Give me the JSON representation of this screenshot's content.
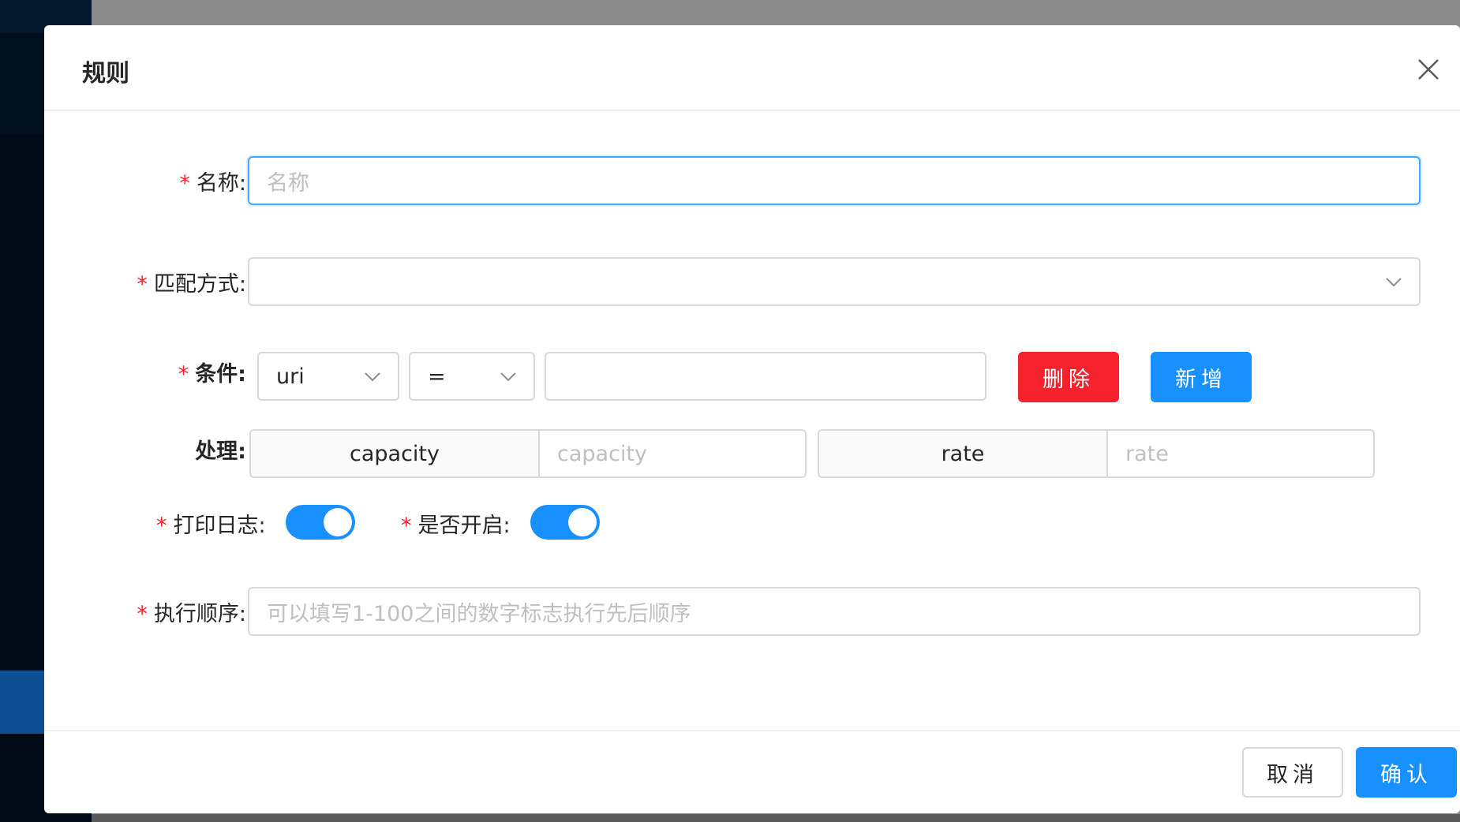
{
  "dialog": {
    "title": "规则",
    "close_icon": "close-icon"
  },
  "form": {
    "name": {
      "label": "名称:",
      "placeholder": "名称",
      "value": ""
    },
    "match_mode": {
      "label": "匹配方式:",
      "value": ""
    },
    "condition": {
      "label": "条件:",
      "param_type": "uri",
      "operator": "=",
      "value": "",
      "delete_label": "删除",
      "add_label": "新增"
    },
    "handle": {
      "label": "处理:",
      "capacity_addon": "capacity",
      "capacity_placeholder": "capacity",
      "rate_addon": "rate",
      "rate_placeholder": "rate"
    },
    "log": {
      "label": "打印日志:",
      "enabled": true
    },
    "enabled": {
      "label": "是否开启:",
      "enabled": true
    },
    "order": {
      "label": "执行顺序:",
      "placeholder": "可以填写1-100之间的数字标志执行先后顺序"
    }
  },
  "footer": {
    "cancel_label": "取消",
    "confirm_label": "确认"
  },
  "colors": {
    "primary": "#1890ff",
    "danger": "#f5222d",
    "required": "#f5222d"
  }
}
